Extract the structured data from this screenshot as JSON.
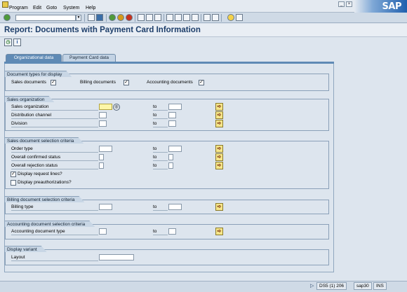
{
  "menu": {
    "items": [
      "Program",
      "Edit",
      "Goto",
      "System",
      "Help"
    ]
  },
  "logo": {
    "text": "SAP"
  },
  "title": "Report: Documents with Payment Card Information",
  "tabs": [
    {
      "label": "Organizational data",
      "active": true
    },
    {
      "label": "Payment Card data",
      "active": false
    }
  ],
  "groups": {
    "doc_types": {
      "title": "Document types for display",
      "sales": {
        "label": "Sales documents",
        "checked": true
      },
      "billing": {
        "label": "Billing documents",
        "checked": true
      },
      "accounting": {
        "label": "Accounting documents",
        "checked": true
      }
    },
    "sales_org": {
      "title": "Sales organization",
      "rows": [
        {
          "label": "Sales organization",
          "to": "to"
        },
        {
          "label": "Distribution channel",
          "to": "to"
        },
        {
          "label": "Division",
          "to": "to"
        }
      ]
    },
    "sales_doc": {
      "title": "Sales document selection criteria",
      "rows": [
        {
          "label": "Order type",
          "to": "to"
        },
        {
          "label": "Overall confirmed status",
          "to": "to"
        },
        {
          "label": "Overall rejection status",
          "to": "to"
        }
      ],
      "chk_request": {
        "label": "Display request lines?",
        "checked": true
      },
      "chk_preauth": {
        "label": "Display preauthorizations?",
        "checked": false
      }
    },
    "billing_doc": {
      "title": "Billing document selection criteria",
      "rows": [
        {
          "label": "Billing type",
          "to": "to"
        }
      ]
    },
    "accounting_doc": {
      "title": "Accounting document selection criteria",
      "rows": [
        {
          "label": "Accounting document type",
          "to": "to"
        }
      ]
    },
    "display_variant": {
      "title": "Display variant",
      "layout_label": "Layout"
    }
  },
  "status": {
    "system": "DS5 (1) 206",
    "server": "sap30",
    "mode": "INS"
  },
  "colors": {
    "accent": "#5f8ab5",
    "title": "#1e3f6b",
    "background": "#dde5ee"
  },
  "icons": [
    "app-icon",
    "enter-icon",
    "save-icon",
    "back-icon",
    "exit-icon",
    "cancel-icon",
    "print-icon",
    "find-icon",
    "execute-icon",
    "info-icon",
    "multiple-selection-icon",
    "help-icon"
  ]
}
